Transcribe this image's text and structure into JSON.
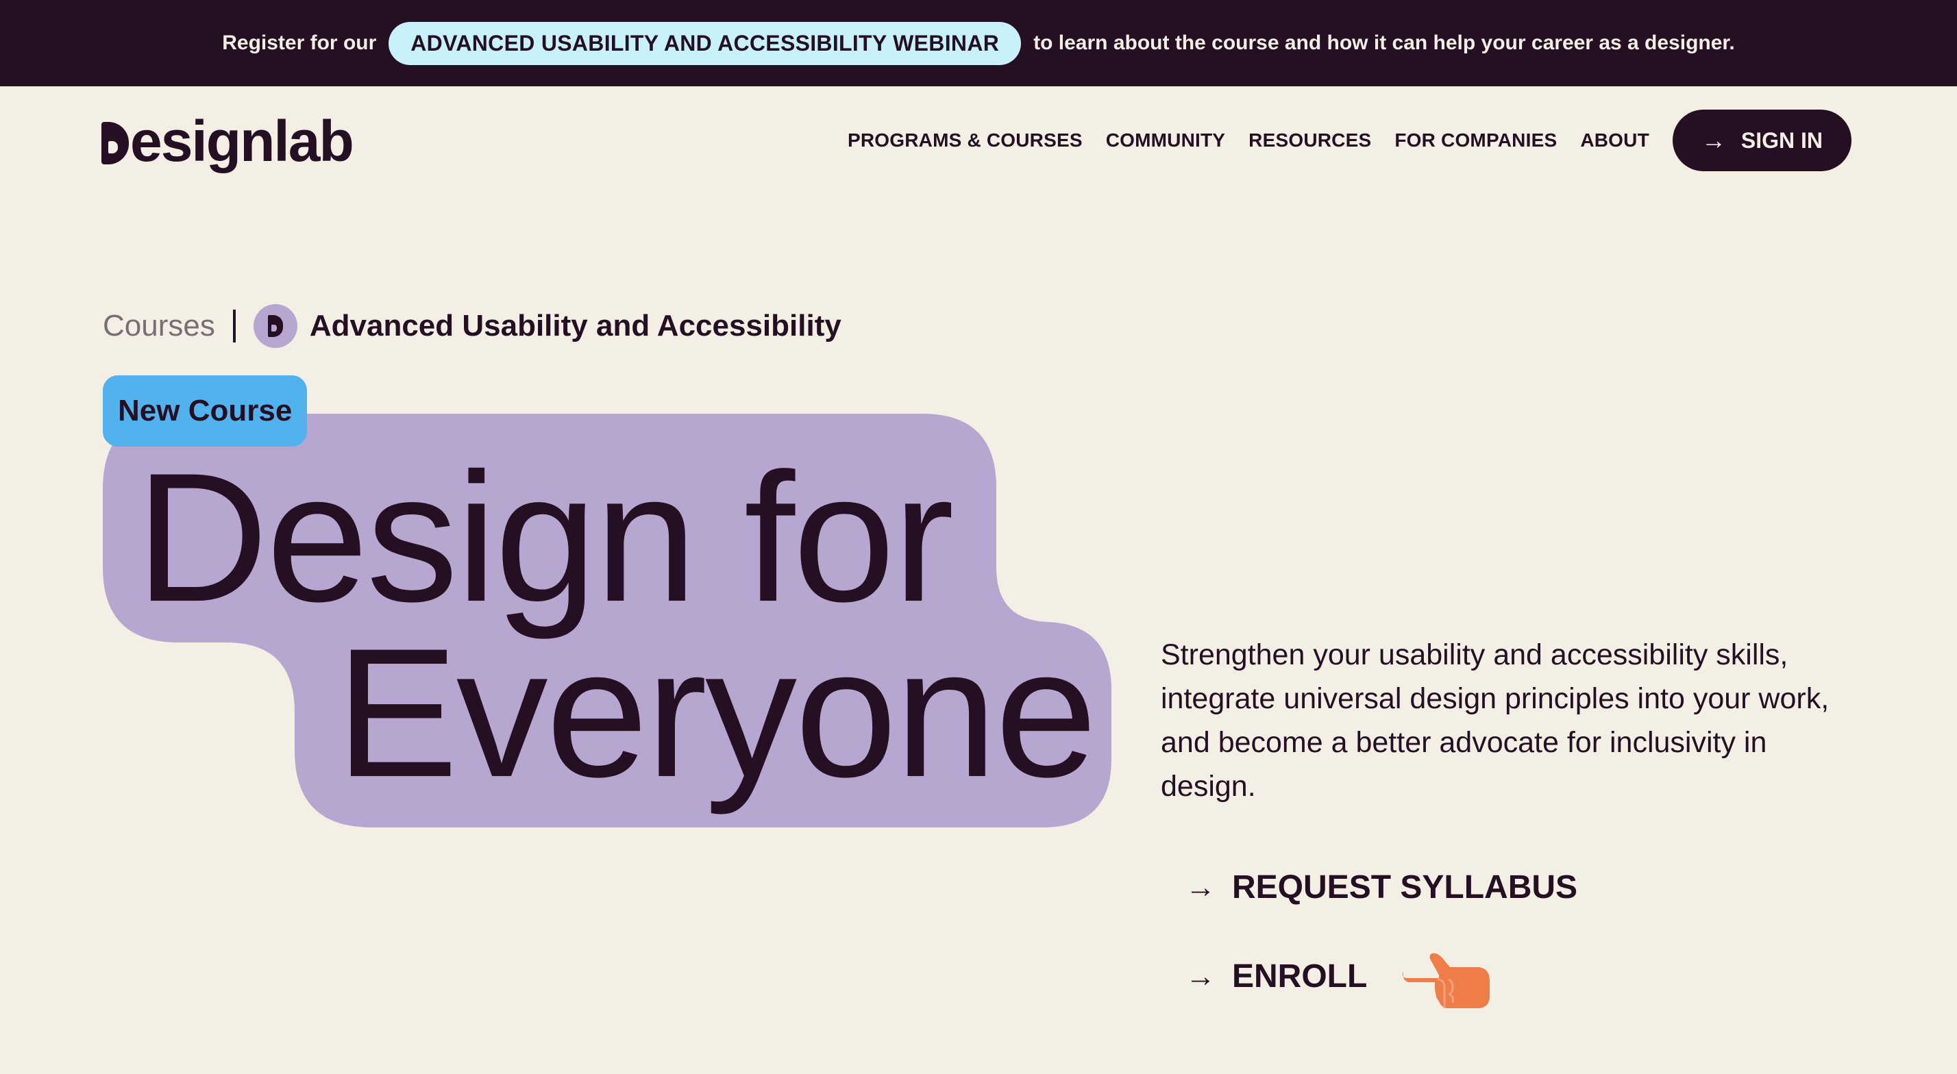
{
  "announcement": {
    "prefix": "Register for our",
    "webinar_label": "ADVANCED USABILITY AND ACCESSIBILITY WEBINAR",
    "suffix": "to learn about the course and how it can help your career as a designer."
  },
  "header": {
    "logo_text": "esignlab",
    "nav": [
      {
        "label": "PROGRAMS & COURSES"
      },
      {
        "label": "COMMUNITY"
      },
      {
        "label": "RESOURCES"
      },
      {
        "label": "FOR COMPANIES"
      },
      {
        "label": "ABOUT"
      }
    ],
    "signin_label": "SIGN IN",
    "signin_icon": "arrow-right-icon"
  },
  "breadcrumb": {
    "parent": "Courses",
    "current": "Advanced Usability and Accessibility",
    "badge_icon": "designlab-d-icon"
  },
  "hero": {
    "tag": "New Course",
    "line1": "Design for",
    "line2": "Everyone",
    "description": "Strengthen your usability and accessibility skills, integrate universal design principles into your work, and become a better advocate for inclusivity in design."
  },
  "ctas": {
    "syllabus": "REQUEST SYLLABUS",
    "enroll": "ENROLL",
    "arrow": "→",
    "pointer_icon": "pointing-hand-icon"
  },
  "colors": {
    "background": "#f3efe5",
    "dark": "#240f23",
    "lavender": "#b6a6d0",
    "sky_blue": "#51b2ee",
    "pill_cyan": "#c8f1fa",
    "hand_orange": "#ef7d4a"
  }
}
